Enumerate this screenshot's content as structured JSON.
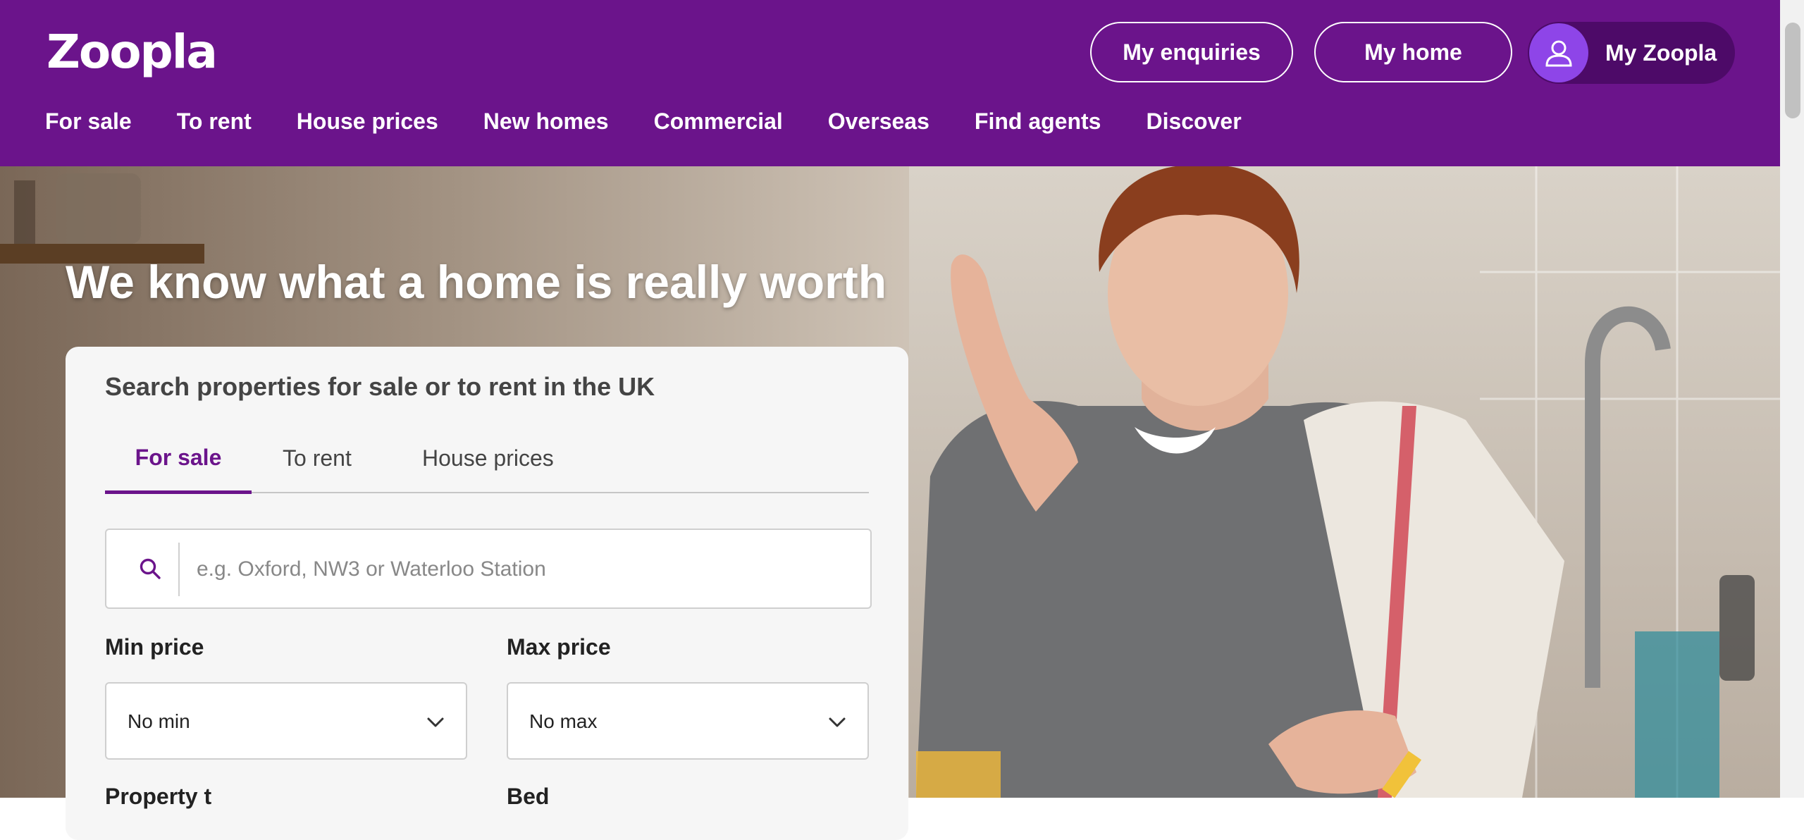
{
  "header": {
    "logo": "Zoopla",
    "buttons": {
      "enquiries": "My enquiries",
      "home": "My home",
      "account": "My Zoopla"
    },
    "nav": [
      "For sale",
      "To rent",
      "House prices",
      "New homes",
      "Commercial",
      "Overseas",
      "Find agents",
      "Discover"
    ]
  },
  "hero": {
    "headline": "We know what a home is really worth"
  },
  "search_card": {
    "title": "Search properties for sale or to rent in the UK",
    "tabs": [
      "For sale",
      "To rent",
      "House prices"
    ],
    "active_tab": "For sale",
    "search": {
      "placeholder": "e.g. Oxford, NW3 or Waterloo Station",
      "value": ""
    },
    "min_price": {
      "label": "Min price",
      "value": "No min"
    },
    "max_price": {
      "label": "Max price",
      "value": "No max"
    },
    "partial_labels": [
      "Property t",
      "Bed"
    ]
  },
  "icons": {
    "search": "search-icon",
    "user": "user-icon",
    "chevron": "chevron-down-icon"
  },
  "colors": {
    "brand": "#6b148b",
    "account_pill": "#4d0a68",
    "avatar": "#8e45e8"
  }
}
